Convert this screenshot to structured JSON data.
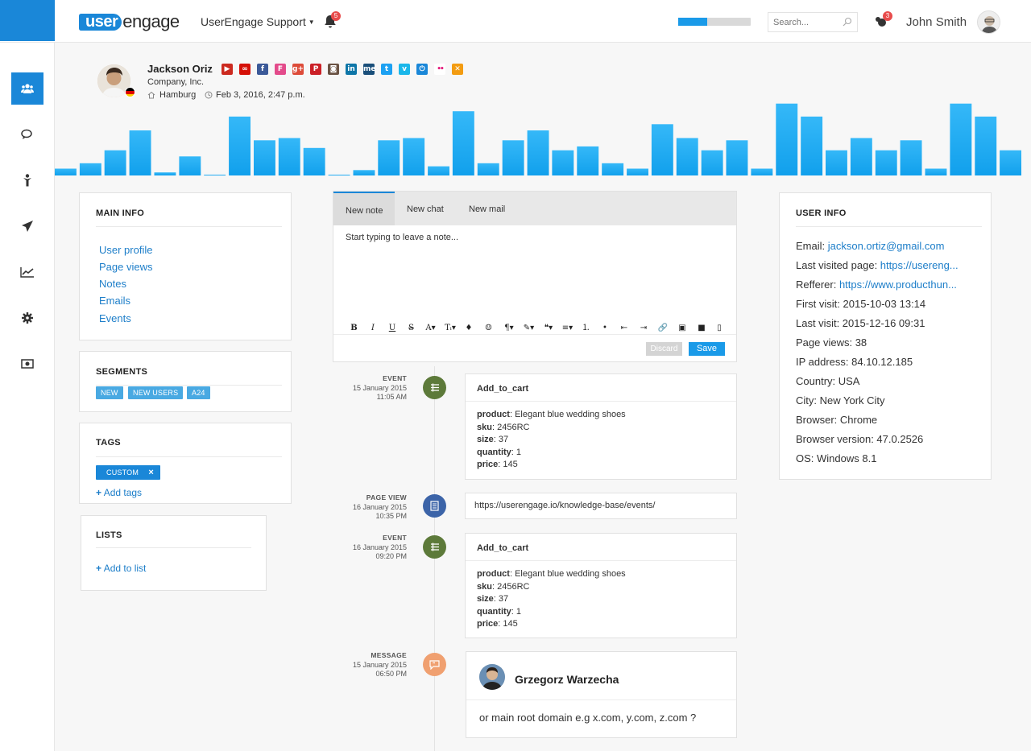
{
  "header": {
    "logo_user": "user",
    "logo_engage": "engage",
    "app_name": "UserEngage Support",
    "notification_count": "5",
    "progress": 0.4,
    "search_placeholder": "Search...",
    "support_count": "3",
    "user_name": "John Smith"
  },
  "sidebar": {
    "items": [
      {
        "name": "users",
        "icon": "users-icon",
        "active": true
      },
      {
        "name": "conversations",
        "icon": "chat-icon",
        "active": false
      },
      {
        "name": "automation",
        "icon": "person-icon",
        "active": false
      },
      {
        "name": "campaigns",
        "icon": "paper-plane-icon",
        "active": false
      },
      {
        "name": "statistics",
        "icon": "chart-icon",
        "active": false
      },
      {
        "name": "settings",
        "icon": "gear-icon",
        "active": false
      },
      {
        "name": "billing",
        "icon": "money-icon",
        "active": false
      }
    ]
  },
  "profile": {
    "name": "Jackson Oriz",
    "company": "Company, Inc.",
    "city": "Hamburg",
    "date": "Feb 3, 2016, 2:47 p.m.",
    "social": [
      {
        "icon": "youtube-icon",
        "color": "#cc2a1f",
        "glyph": "▶"
      },
      {
        "icon": "lastfm-icon",
        "color": "#d51007",
        "glyph": "∞"
      },
      {
        "icon": "facebook-icon",
        "color": "#3b5998",
        "glyph": "f"
      },
      {
        "icon": "foursquare-icon",
        "color": "#e34b8b",
        "glyph": "F"
      },
      {
        "icon": "googleplus-icon",
        "color": "#dd4b39",
        "glyph": "g+"
      },
      {
        "icon": "pinterest-icon",
        "color": "#cb2027",
        "glyph": "P"
      },
      {
        "icon": "instagram-icon",
        "color": "#6b5344",
        "glyph": "◙"
      },
      {
        "icon": "linkedin-icon",
        "color": "#0e76a8",
        "glyph": "in"
      },
      {
        "icon": "myspace-icon",
        "color": "#1a4f7a",
        "glyph": "me"
      },
      {
        "icon": "twitter-icon",
        "color": "#1da1f2",
        "glyph": "t"
      },
      {
        "icon": "vimeo-icon",
        "color": "#1ab7ea",
        "glyph": "v"
      },
      {
        "icon": "power-icon",
        "color": "#1a87d8",
        "glyph": "⏻"
      },
      {
        "icon": "flickr-icon",
        "color": "#ffffff",
        "glyph": "••"
      },
      {
        "icon": "xing-icon",
        "color": "#f39c12",
        "glyph": "✕"
      }
    ]
  },
  "activity_bars": [
    0.09,
    0.16,
    0.33,
    0.59,
    0.04,
    0.25,
    0.0,
    0.77,
    0.46,
    0.49,
    0.36,
    0.01,
    0.07,
    0.46,
    0.49,
    0.12,
    0.84,
    0.16,
    0.46,
    0.59,
    0.33,
    0.38,
    0.16,
    0.09,
    0.67,
    0.49,
    0.33,
    0.46,
    0.09,
    0.94,
    0.77,
    0.33,
    0.49,
    0.33,
    0.46,
    0.09,
    0.94,
    0.77,
    0.33
  ],
  "main_info": {
    "title": "MAIN INFO",
    "links": [
      "User profile",
      "Page views",
      "Notes",
      "Emails",
      "Events"
    ]
  },
  "segments": {
    "title": "SEGMENTS",
    "tags": [
      "NEW",
      "NEW USERS",
      "A24"
    ]
  },
  "tags": {
    "title": "TAGS",
    "tag": "CUSTOM",
    "remove": "×",
    "add": "Add tags"
  },
  "lists": {
    "title": "LISTS",
    "add": "Add to list"
  },
  "editor": {
    "tabs": [
      "New note",
      "New chat",
      "New mail"
    ],
    "placeholder": "Start typing to leave a note...",
    "toolbar": [
      "B",
      "I",
      "U",
      "S",
      "A▾",
      "Tᵢ▾",
      "♦",
      "☺",
      "¶▾",
      "✎▾",
      "❝▾",
      "≡▾",
      "⒈",
      "•",
      "⇤",
      "⇥",
      "🔗",
      "▣",
      "■",
      "▯"
    ],
    "discard": "Discard",
    "save": "Save"
  },
  "timeline": [
    {
      "type": "EVENT",
      "date": "15 January 2015",
      "time": "11:05 AM",
      "color": "#5d7a3a",
      "title": "Add_to_cart",
      "fields": [
        {
          "k": "product",
          "v": "Elegant blue wedding shoes"
        },
        {
          "k": "sku",
          "v": "2456RC"
        },
        {
          "k": "size",
          "v": "37"
        },
        {
          "k": "quantity",
          "v": "1"
        },
        {
          "k": "price",
          "v": "145"
        }
      ]
    },
    {
      "type": "PAGE VIEW",
      "date": "16 January 2015",
      "time": "10:35 PM",
      "color": "#3c64a8",
      "url": "https://userengage.io/knowledge-base/events/"
    },
    {
      "type": "EVENT",
      "date": "16 January 2015",
      "time": "09:20 PM",
      "color": "#5d7a3a",
      "title": "Add_to_cart",
      "fields": [
        {
          "k": "product",
          "v": "Elegant blue wedding shoes"
        },
        {
          "k": "sku",
          "v": "2456RC"
        },
        {
          "k": "size",
          "v": "37"
        },
        {
          "k": "quantity",
          "v": "1"
        },
        {
          "k": "price",
          "v": "145"
        }
      ]
    },
    {
      "type": "MESSAGE",
      "date": "15 January 2015",
      "time": "06:50 PM",
      "color": "#f0a070",
      "author": "Grzegorz Warzecha",
      "text": "or main root domain e.g x.com, y.com, z.com ?"
    }
  ],
  "user_info": {
    "title": "USER INFO",
    "rows": [
      {
        "k": "Email:",
        "v": "jackson.ortiz@gmail.com",
        "link": true
      },
      {
        "k": "Last visited page:",
        "v": "https://usereng...",
        "link": true
      },
      {
        "k": "Refferer:",
        "v": "https://www.producthun...",
        "link": true
      },
      {
        "k": "First visit:",
        "v": "2015-10-03 13:14",
        "link": false
      },
      {
        "k": "Last visit:",
        "v": "2015-12-16 09:31",
        "link": false
      },
      {
        "k": "Page views:",
        "v": "38",
        "link": false
      },
      {
        "k": "IP address:",
        "v": "84.10.12.185",
        "link": false
      },
      {
        "k": "Country:",
        "v": "USA",
        "link": false
      },
      {
        "k": "City:",
        "v": "New York City",
        "link": false
      },
      {
        "k": "Browser:",
        "v": "Chrome",
        "link": false
      },
      {
        "k": "Browser version:",
        "v": "47.0.2526",
        "link": false
      },
      {
        "k": "OS:",
        "v": "Windows 8.1",
        "link": false
      }
    ]
  }
}
